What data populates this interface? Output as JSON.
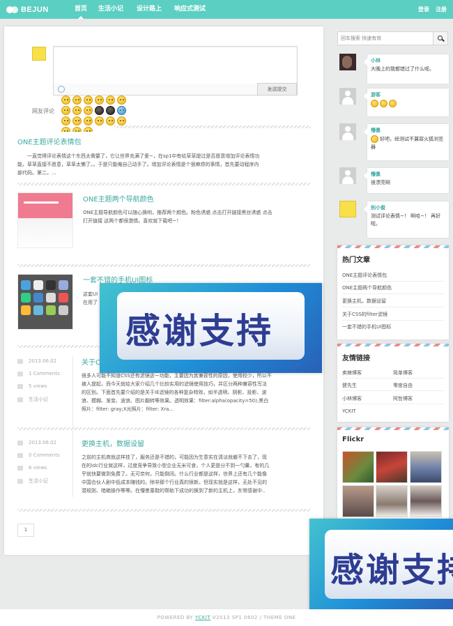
{
  "header": {
    "logo": "BEJUN",
    "nav": [
      "首页",
      "生活小记",
      "设计路上",
      "响应式测试"
    ],
    "login": "登录",
    "register": "注册"
  },
  "comment_form": {
    "label": "网友评论",
    "submit": "发送提交"
  },
  "posts": [
    {
      "title": "ONE主题评论表情包",
      "excerpt_lines": [
        "一直觉得评论表情这个东西太需要了，它让世界充满了爱~，在sp1中有给草草提过是否愿意增加评论表情功",
        "能，草草直接不愿意，草草太懒了。。于是只能俺自己动手了。增加评论表情是个很麻烦的事情，首先要动程序内",
        "部代码。第二，..."
      ]
    },
    {
      "title": "ONE主题两个导航颜色",
      "excerpt_lines": [
        "ONE主题导航颜色可以随心换哟，推荐两个颜色。粉色诱惑 点击打开链接黑丝诱惑 点击",
        "打开链接 这两个都很激情。喜欢就下载吧~！"
      ]
    },
    {
      "title": "一套不错的手机UI图标",
      "excerpt_lines": [
        "这套UI",
        "在用了"
      ]
    },
    {
      "title": "关于CSS的filter滤镜",
      "date": "2013.06.02",
      "comments": "1 Comments",
      "views": "5 views",
      "category": "生活小记",
      "excerpt_lines": [
        "很多人可能不知道CSS还有滤镜这一功能，主要因为其兼容性的原因，使用较少，所以不",
        "被人提起，而今天就给大家介绍几个比较实用的滤镜使用技巧，并区分两种兼容性写法",
        "的区别。下面首先要介绍的是关于IE滤镜的各种复杂特效，如半透明、阴影、投影、波",
        "浪、模糊、渐变、波浪、图片翻转等效果。透明效果：filter:alpha(opacity=50);黑白",
        "照片：filter: gray;X光照片：filter: Xra..."
      ]
    },
    {
      "title": "更换主机，数据设留",
      "date": "2013.06.02",
      "comments": "0 Comments",
      "views": "6 views",
      "category": "生活小记",
      "excerpt_lines": [
        "之前的主机商就这样挂了，服务还是不错的，可能因为生意实在清淡就撤不下去了，现",
        "在的idc行业就这样，过度竞争导致小型企业无米可食，个人更是分不到一勺羹，有的几",
        "乎就快要做到免费了。无可奈何，只能倒闭。什么行业都是这样，世界上还有几个能像",
        "中国合伙人剧中低成本赚钱的。除非那个行业真的很新。但现实就是这样，无处不见的",
        "潜规则、暗箱操作等等。在懵墨童鞋的帮助下成功的换到了新的主机上，东常感谢中.."
      ]
    }
  ],
  "pager": "1",
  "thanks_text": "感谢支持",
  "sidebar": {
    "search_placeholder": "回车搜索 快速有效",
    "recent_comments": [
      {
        "name": "小林",
        "text": "大晚上的我都错过了什么呢。"
      },
      {
        "name": "游客",
        "text": ""
      },
      {
        "name": "懵墨",
        "text": "好吧，经测试不兼容火狐浏览器"
      },
      {
        "name": "懵墨",
        "text": "很漂亮啊"
      },
      {
        "name": "别小俊",
        "text": "测试评论表情~！ 啊哈~！ 再好啦。"
      }
    ],
    "hot_title": "热门文章",
    "hot_posts": [
      "ONE主题评论表情包",
      "ONE主题两个导航颜色",
      "更换主机，数据设留",
      "关于CSS的filter滤镜",
      "一套不错的手机UI图标"
    ],
    "links_title": "友情链接",
    "links": [
      "卖辣博客",
      "简单博客",
      "健先生",
      "零度自由",
      "小林博客",
      "阿哲博客",
      "YCKIT"
    ],
    "flickr_title": "Flickr"
  },
  "footer": {
    "powered": "POWERED BY",
    "link": "YCKIT",
    "rest": "V2013 SP1 0602 / THEME ONE"
  }
}
